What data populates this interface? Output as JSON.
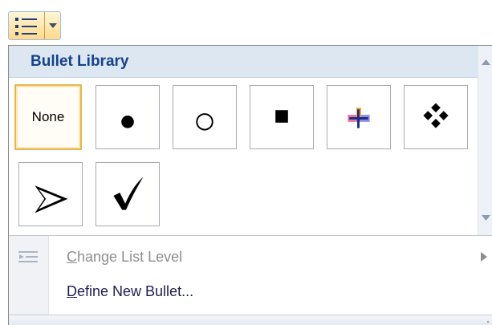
{
  "toolbar": {
    "split_button": {
      "icon": "bullet-list-icon",
      "dropdown_icon": "chevron-down-icon"
    }
  },
  "gallery": {
    "header": "Bullet Library",
    "items": [
      {
        "name": "None",
        "icon": "none",
        "selected": true
      },
      {
        "name": "filled-circle",
        "icon": "filled-circle-bullet-icon",
        "selected": false
      },
      {
        "name": "hollow-circle",
        "icon": "hollow-circle-bullet-icon",
        "selected": false
      },
      {
        "name": "filled-square",
        "icon": "filled-square-bullet-icon",
        "selected": false
      },
      {
        "name": "cross",
        "icon": "crosshair-bullet-icon",
        "selected": false
      },
      {
        "name": "diamonds",
        "icon": "four-diamonds-bullet-icon",
        "selected": false
      },
      {
        "name": "arrowhead",
        "icon": "arrowhead-bullet-icon",
        "selected": false
      },
      {
        "name": "checkmark",
        "icon": "checkmark-bullet-icon",
        "selected": false
      }
    ]
  },
  "menu": {
    "change_list_level": {
      "accel": "C",
      "rest": "hange List Level",
      "enabled": false,
      "icon": "list-level-icon"
    },
    "define_new_bullet": {
      "accel": "D",
      "rest": "efine New Bullet...",
      "enabled": true
    }
  },
  "colors": {
    "header_bg": "#dde7f2",
    "header_text": "#15428b",
    "selected_border": "#e7b64e",
    "disabled_text": "#8d8d8d"
  }
}
